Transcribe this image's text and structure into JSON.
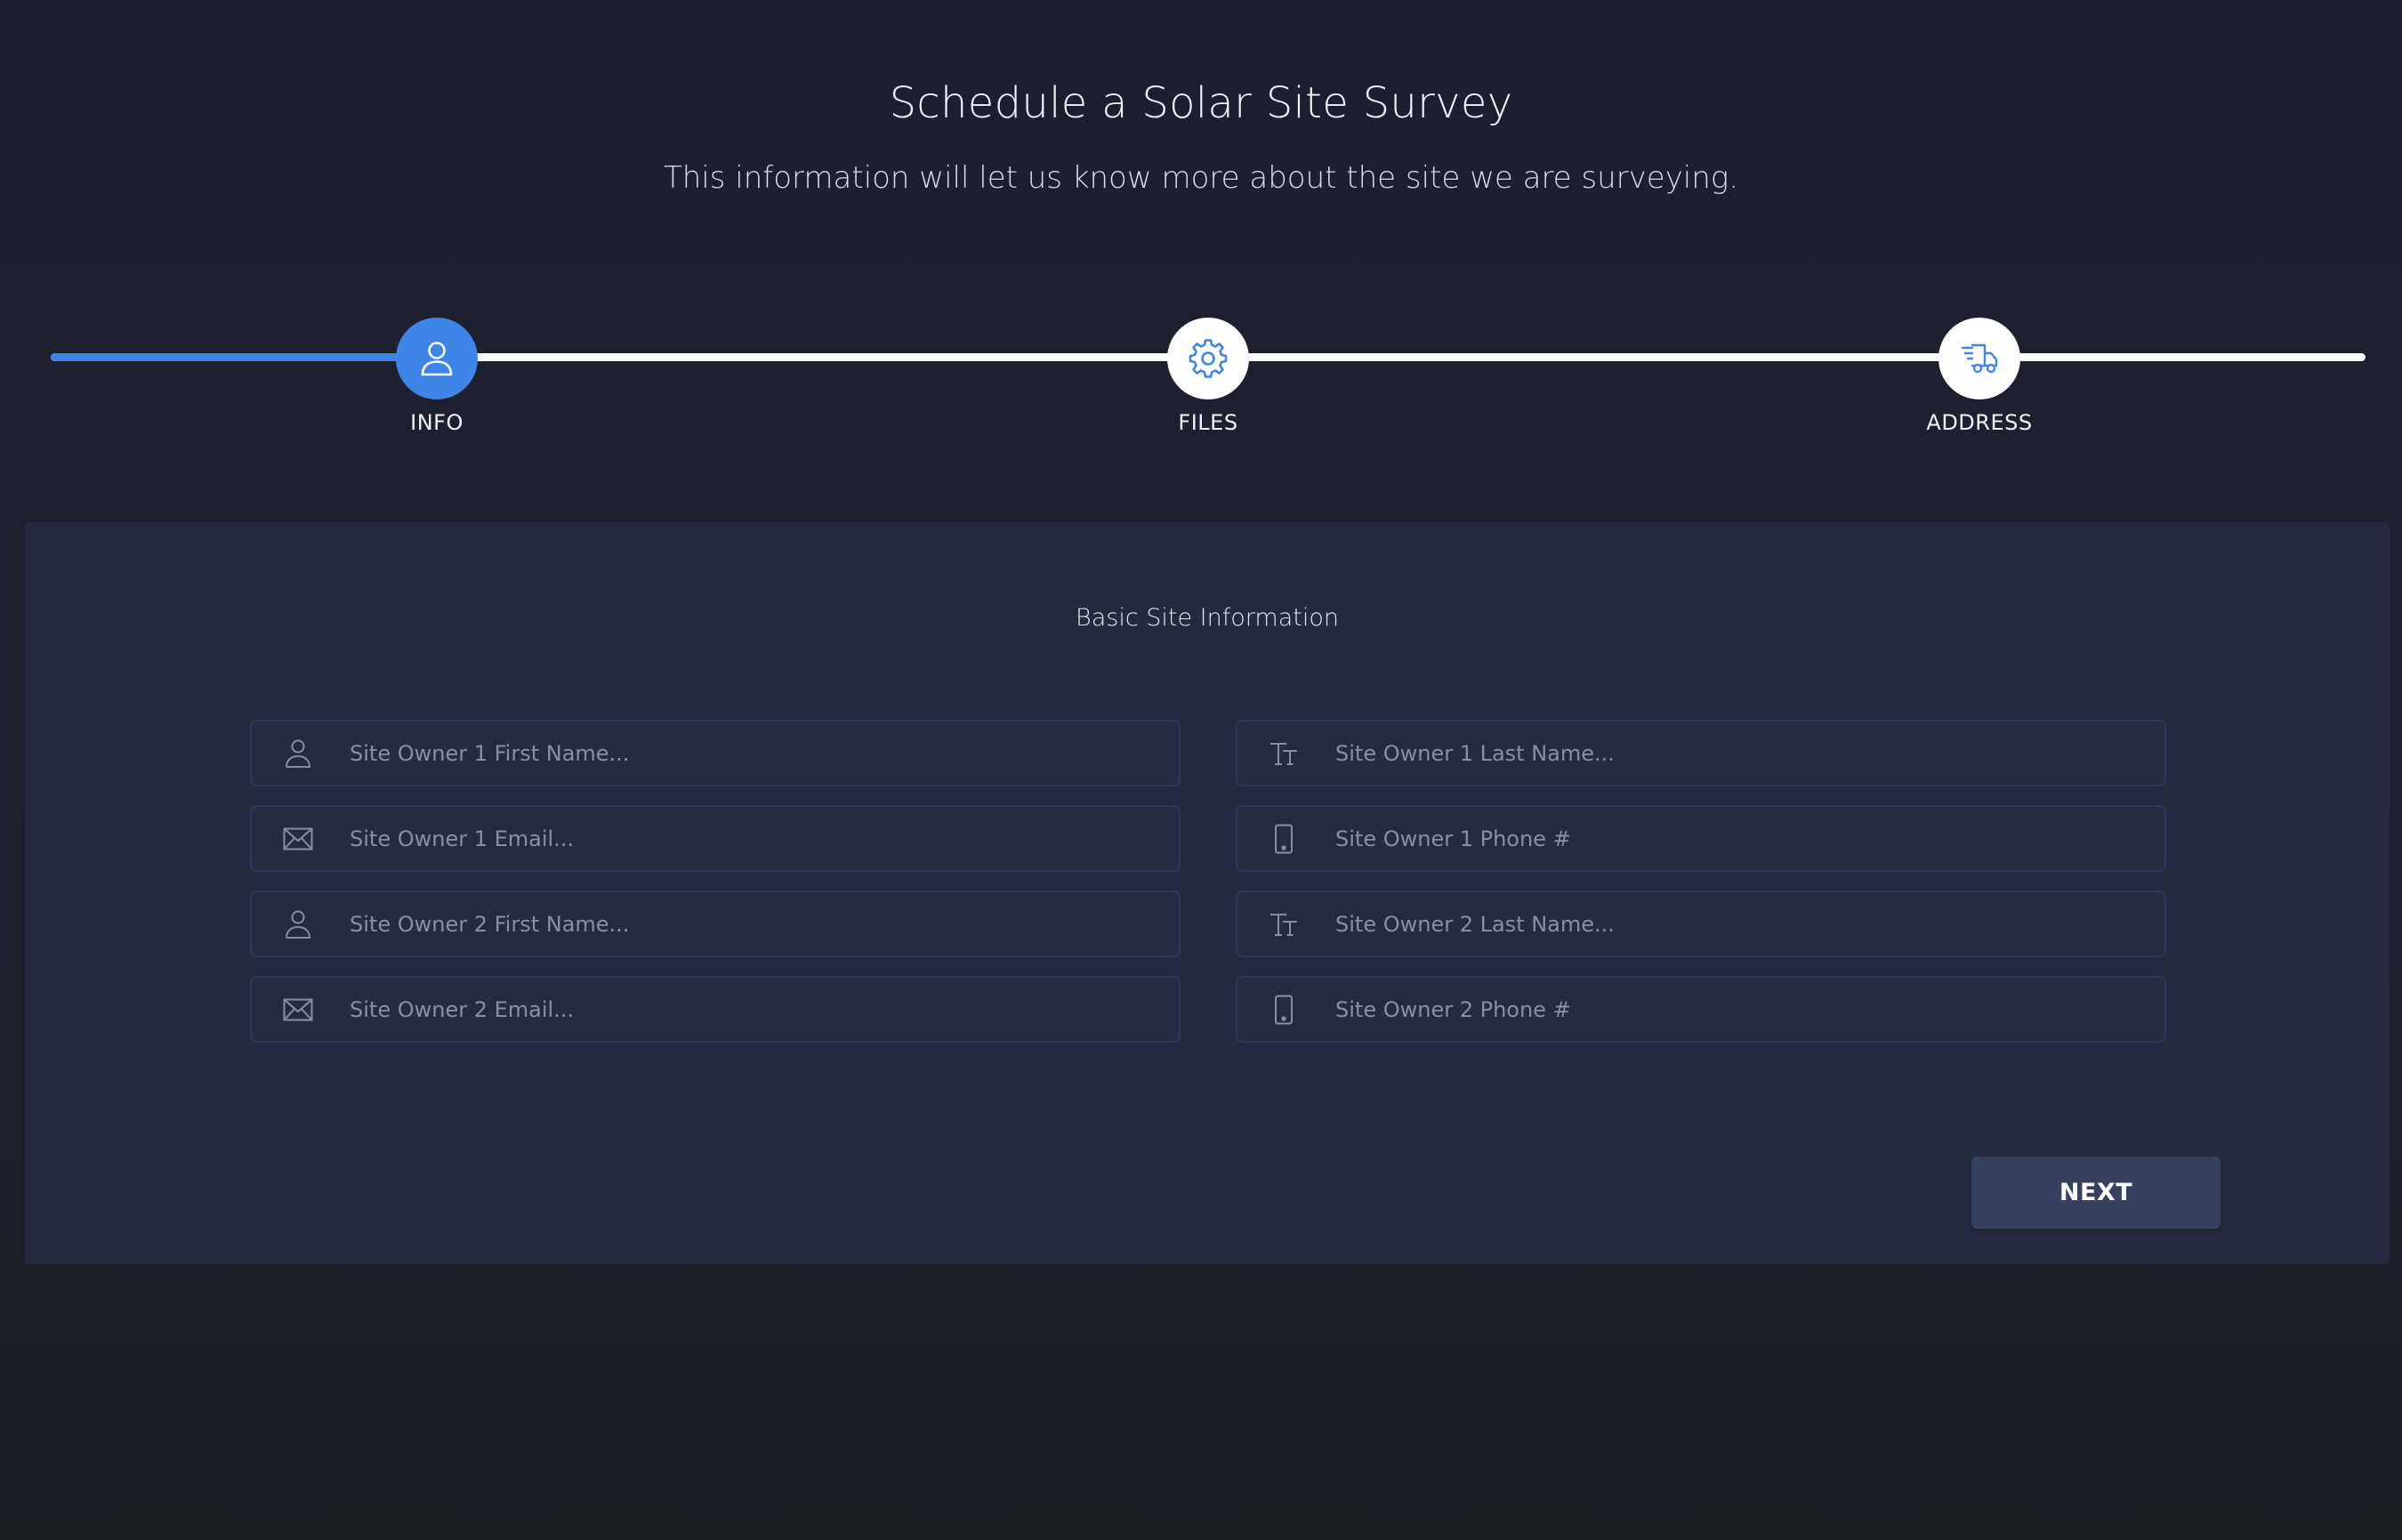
{
  "header": {
    "title": "Schedule a Solar Site Survey",
    "subtitle": "This information will let us know more about the site we are surveying."
  },
  "stepper": {
    "progress_fraction": 0.167,
    "accent_color": "#3d86e8",
    "steps": [
      {
        "label": "INFO",
        "icon": "user-icon",
        "active": true
      },
      {
        "label": "FILES",
        "icon": "gear-icon",
        "active": false
      },
      {
        "label": "ADDRESS",
        "icon": "delivery-truck-icon",
        "active": false
      }
    ]
  },
  "form": {
    "title": "Basic Site Information",
    "fields": [
      {
        "icon": "user-icon",
        "placeholder": "Site Owner 1 First Name...",
        "value": ""
      },
      {
        "icon": "text-size-icon",
        "placeholder": "Site Owner 1 Last Name...",
        "value": ""
      },
      {
        "icon": "envelope-icon",
        "placeholder": "Site Owner 1 Email...",
        "value": ""
      },
      {
        "icon": "phone-icon",
        "placeholder": "Site Owner 1 Phone #",
        "value": ""
      },
      {
        "icon": "user-icon",
        "placeholder": "Site Owner 2 First Name...",
        "value": ""
      },
      {
        "icon": "text-size-icon",
        "placeholder": "Site Owner 2 Last Name...",
        "value": ""
      },
      {
        "icon": "envelope-icon",
        "placeholder": "Site Owner 2 Email...",
        "value": ""
      },
      {
        "icon": "phone-icon",
        "placeholder": "Site Owner 2 Phone #",
        "value": ""
      }
    ],
    "next_label": "NEXT"
  }
}
